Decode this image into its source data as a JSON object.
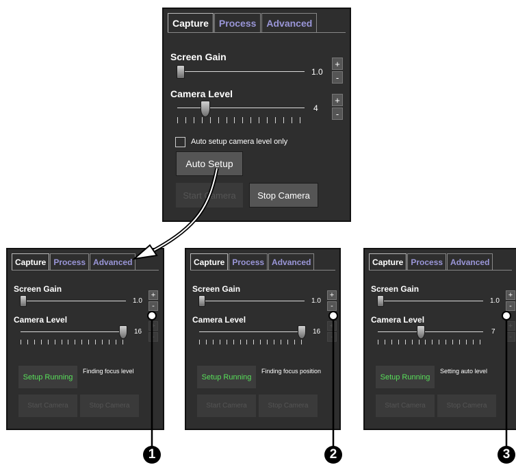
{
  "tabs": {
    "capture": "Capture",
    "process": "Process",
    "advanced": "Advanced"
  },
  "main": {
    "screen_gain_label": "Screen Gain",
    "screen_gain_value": "1.0",
    "camera_level_label": "Camera Level",
    "camera_level_value": "4",
    "plus": "+",
    "minus": "-",
    "checkbox_label": "Auto setup camera level only",
    "auto_setup_button": "Auto Setup",
    "start_camera_button": "Start Camera",
    "stop_camera_button": "Stop Camera"
  },
  "steps": [
    {
      "callout": "1",
      "screen_gain_value": "1.0",
      "camera_level_value": "16",
      "running_button": "Setup Running",
      "status": "Finding focus level",
      "start_camera_button": "Start Camera",
      "stop_camera_button": "Stop Camera"
    },
    {
      "callout": "2",
      "screen_gain_value": "1.0",
      "camera_level_value": "16",
      "running_button": "Setup Running",
      "status": "Finding focus position",
      "start_camera_button": "Start Camera",
      "stop_camera_button": "Stop Camera"
    },
    {
      "callout": "3",
      "screen_gain_value": "1.0",
      "camera_level_value": "7",
      "running_button": "Setup Running",
      "status": "Setting auto level",
      "start_camera_button": "Start Camera",
      "stop_camera_button": "Stop Camera"
    }
  ],
  "colors": {
    "panel_bg": "#2e2e2e",
    "inactive_tab_text": "#9a96d8",
    "running_text": "#58e05a"
  },
  "icons": {
    "callout_marker": "numbered-callout-circle",
    "connector": "curved-arrow"
  }
}
